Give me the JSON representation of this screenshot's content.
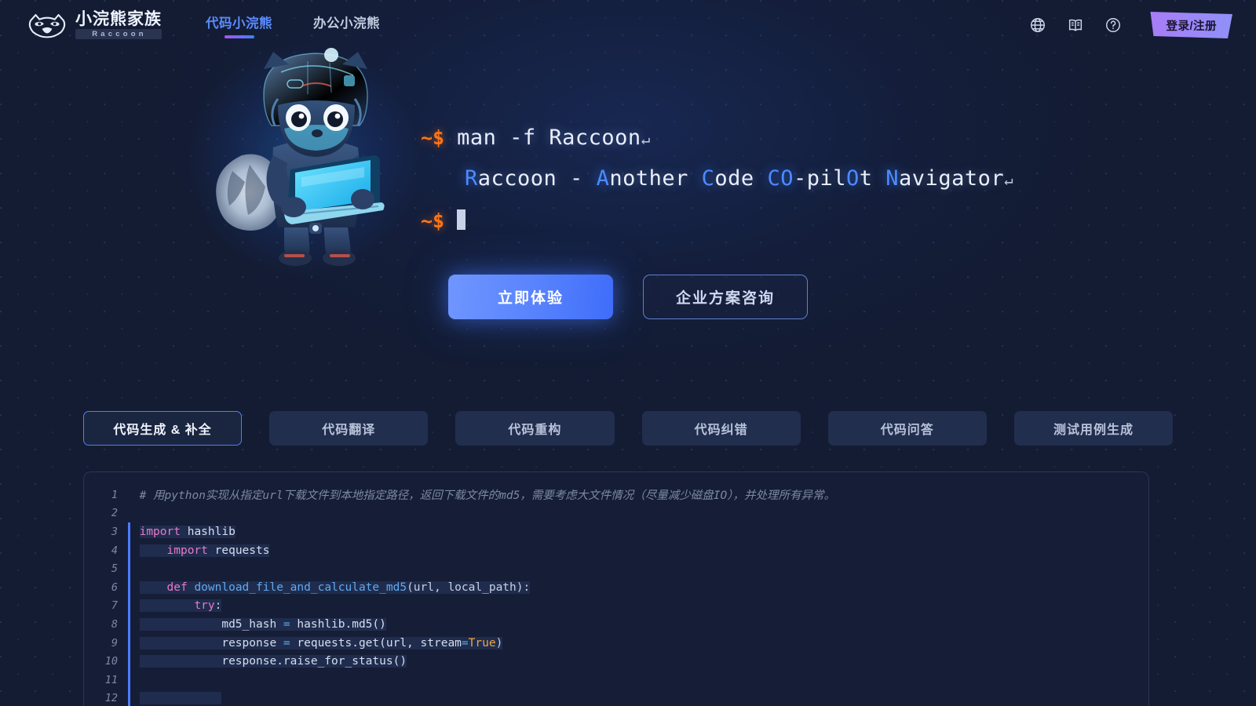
{
  "header": {
    "logo": {
      "icon": "raccoon-face-icon",
      "title": "小浣熊家族",
      "subtitle": "Raccoon"
    },
    "nav": [
      {
        "label": "代码小浣熊",
        "active": true
      },
      {
        "label": "办公小浣熊",
        "active": false
      }
    ],
    "icons": [
      {
        "name": "globe-icon",
        "glyph": "globe"
      },
      {
        "name": "book-icon",
        "glyph": "book"
      },
      {
        "name": "help-icon",
        "glyph": "question"
      }
    ],
    "login_label": "登录/注册"
  },
  "hero": {
    "mascot_alt": "raccoon-mascot",
    "terminal": {
      "prompt": "~$",
      "command": "man -f Raccoon",
      "return_glyph": "↵",
      "description_prefix": "",
      "description_parts": [
        {
          "text": "R",
          "highlight": true
        },
        {
          "text": "accoon - ",
          "highlight": false
        },
        {
          "text": "A",
          "highlight": true
        },
        {
          "text": "nother ",
          "highlight": false
        },
        {
          "text": "C",
          "highlight": true
        },
        {
          "text": "ode ",
          "highlight": false
        },
        {
          "text": "C",
          "highlight": true
        },
        {
          "text": "",
          "highlight": false
        },
        {
          "text": "O",
          "highlight": true
        },
        {
          "text": "-pil",
          "highlight": false
        },
        {
          "text": "O",
          "highlight": true
        },
        {
          "text": "t ",
          "highlight": false
        },
        {
          "text": "N",
          "highlight": true
        },
        {
          "text": "avigator",
          "highlight": false
        }
      ],
      "description_plain": "Raccoon - Another Code CO-pilOt Navigator"
    },
    "cta": {
      "primary_label": "立即体验",
      "secondary_label": "企业方案咨询"
    }
  },
  "tabs": [
    {
      "label": "代码生成 & 补全",
      "active": true
    },
    {
      "label": "代码翻译",
      "active": false
    },
    {
      "label": "代码重构",
      "active": false
    },
    {
      "label": "代码纠错",
      "active": false
    },
    {
      "label": "代码问答",
      "active": false
    },
    {
      "label": "测试用例生成",
      "active": false
    }
  ],
  "code": {
    "language": "python",
    "lines": [
      {
        "n": "1",
        "generated": false,
        "tokens": [
          {
            "t": "# 用python实现从指定url下载文件到本地指定路径，返回下载文件的md5，需要考虑大文件情况（尽量减少磁盘IO），并处理所有异常。",
            "c": "c-comment"
          }
        ]
      },
      {
        "n": "2",
        "generated": false,
        "tokens": []
      },
      {
        "n": "3",
        "generated": true,
        "tokens": [
          {
            "t": "import",
            "c": "c-kw"
          },
          {
            "t": " hashlib",
            "c": "c-plain"
          }
        ]
      },
      {
        "n": "4",
        "generated": true,
        "tokens": [
          {
            "t": "    ",
            "c": "c-plain"
          },
          {
            "t": "import",
            "c": "c-kw"
          },
          {
            "t": " requests",
            "c": "c-plain"
          }
        ]
      },
      {
        "n": "5",
        "generated": true,
        "tokens": []
      },
      {
        "n": "6",
        "generated": true,
        "tokens": [
          {
            "t": "    ",
            "c": "c-plain"
          },
          {
            "t": "def",
            "c": "c-kw"
          },
          {
            "t": " ",
            "c": "c-plain"
          },
          {
            "t": "download_file_and_calculate_md5",
            "c": "c-fn"
          },
          {
            "t": "(url, local_path):",
            "c": "c-punc"
          }
        ]
      },
      {
        "n": "7",
        "generated": true,
        "tokens": [
          {
            "t": "        ",
            "c": "c-plain"
          },
          {
            "t": "try",
            "c": "c-kw"
          },
          {
            "t": ":",
            "c": "c-punc"
          }
        ]
      },
      {
        "n": "8",
        "generated": true,
        "tokens": [
          {
            "t": "            md5_hash ",
            "c": "c-plain"
          },
          {
            "t": "=",
            "c": "c-op"
          },
          {
            "t": " hashlib.md5()",
            "c": "c-plain"
          }
        ]
      },
      {
        "n": "9",
        "generated": true,
        "tokens": [
          {
            "t": "            response ",
            "c": "c-plain"
          },
          {
            "t": "=",
            "c": "c-op"
          },
          {
            "t": " requests.get(url, stream",
            "c": "c-plain"
          },
          {
            "t": "=",
            "c": "c-op"
          },
          {
            "t": "True",
            "c": "c-const"
          },
          {
            "t": ")",
            "c": "c-punc"
          }
        ]
      },
      {
        "n": "10",
        "generated": true,
        "tokens": [
          {
            "t": "            response.raise_for_status()",
            "c": "c-plain"
          }
        ]
      },
      {
        "n": "11",
        "generated": true,
        "tokens": []
      },
      {
        "n": "12",
        "generated": true,
        "tokens": [
          {
            "t": "            ",
            "c": "c-plain"
          }
        ]
      }
    ]
  },
  "colors": {
    "background": "#131c33",
    "panel": "#151e36",
    "accent_blue": "#4d8bff",
    "prompt_orange": "#ff7518",
    "login_gradient_from": "#a87cf5",
    "login_gradient_to": "#8f91f8",
    "nav_underline_from": "#a855f7",
    "nav_underline_to": "#3b82f6",
    "keyword_pink": "#e879c9",
    "function_blue": "#61a9f0",
    "constant_orange": "#f0a44a"
  }
}
